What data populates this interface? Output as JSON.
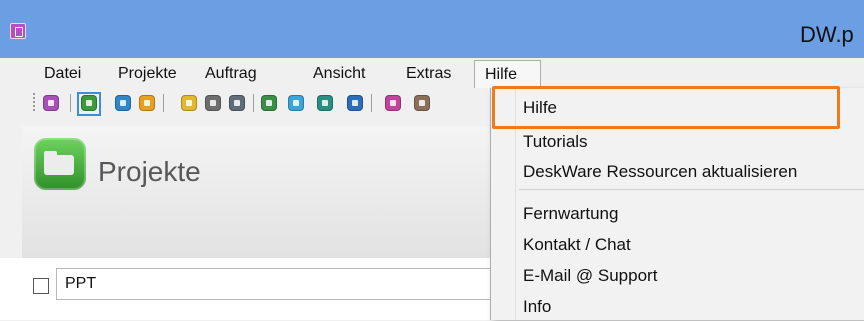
{
  "window": {
    "title": "DW.p"
  },
  "menubar": {
    "items": [
      "Datei",
      "Projekte",
      "Auftrag",
      "Ansicht",
      "Extras"
    ],
    "open_menu": "Hilfe"
  },
  "help_menu": {
    "items": [
      "Hilfe",
      "Tutorials",
      "DeskWare Ressourcen aktualisieren",
      "Fernwartung",
      "Kontakt / Chat",
      "E-Mail @ Support",
      "Info"
    ]
  },
  "toolbar": {
    "icons": [
      "purple-p-icon",
      "projects-icon",
      "mail-icon",
      "gear-icon",
      "folder-icon",
      "print-icon",
      "document-icon",
      "green-icon",
      "refresh-icon",
      "teal-icon",
      "lock-icon",
      "pink-icon",
      "home-icon"
    ]
  },
  "page": {
    "title": "Projekte"
  },
  "entry": {
    "value": "PPT"
  },
  "colors": {
    "titlebar": "#6b9ee3",
    "highlight": "#f07a1a",
    "accent_green": "#4cb13f"
  }
}
